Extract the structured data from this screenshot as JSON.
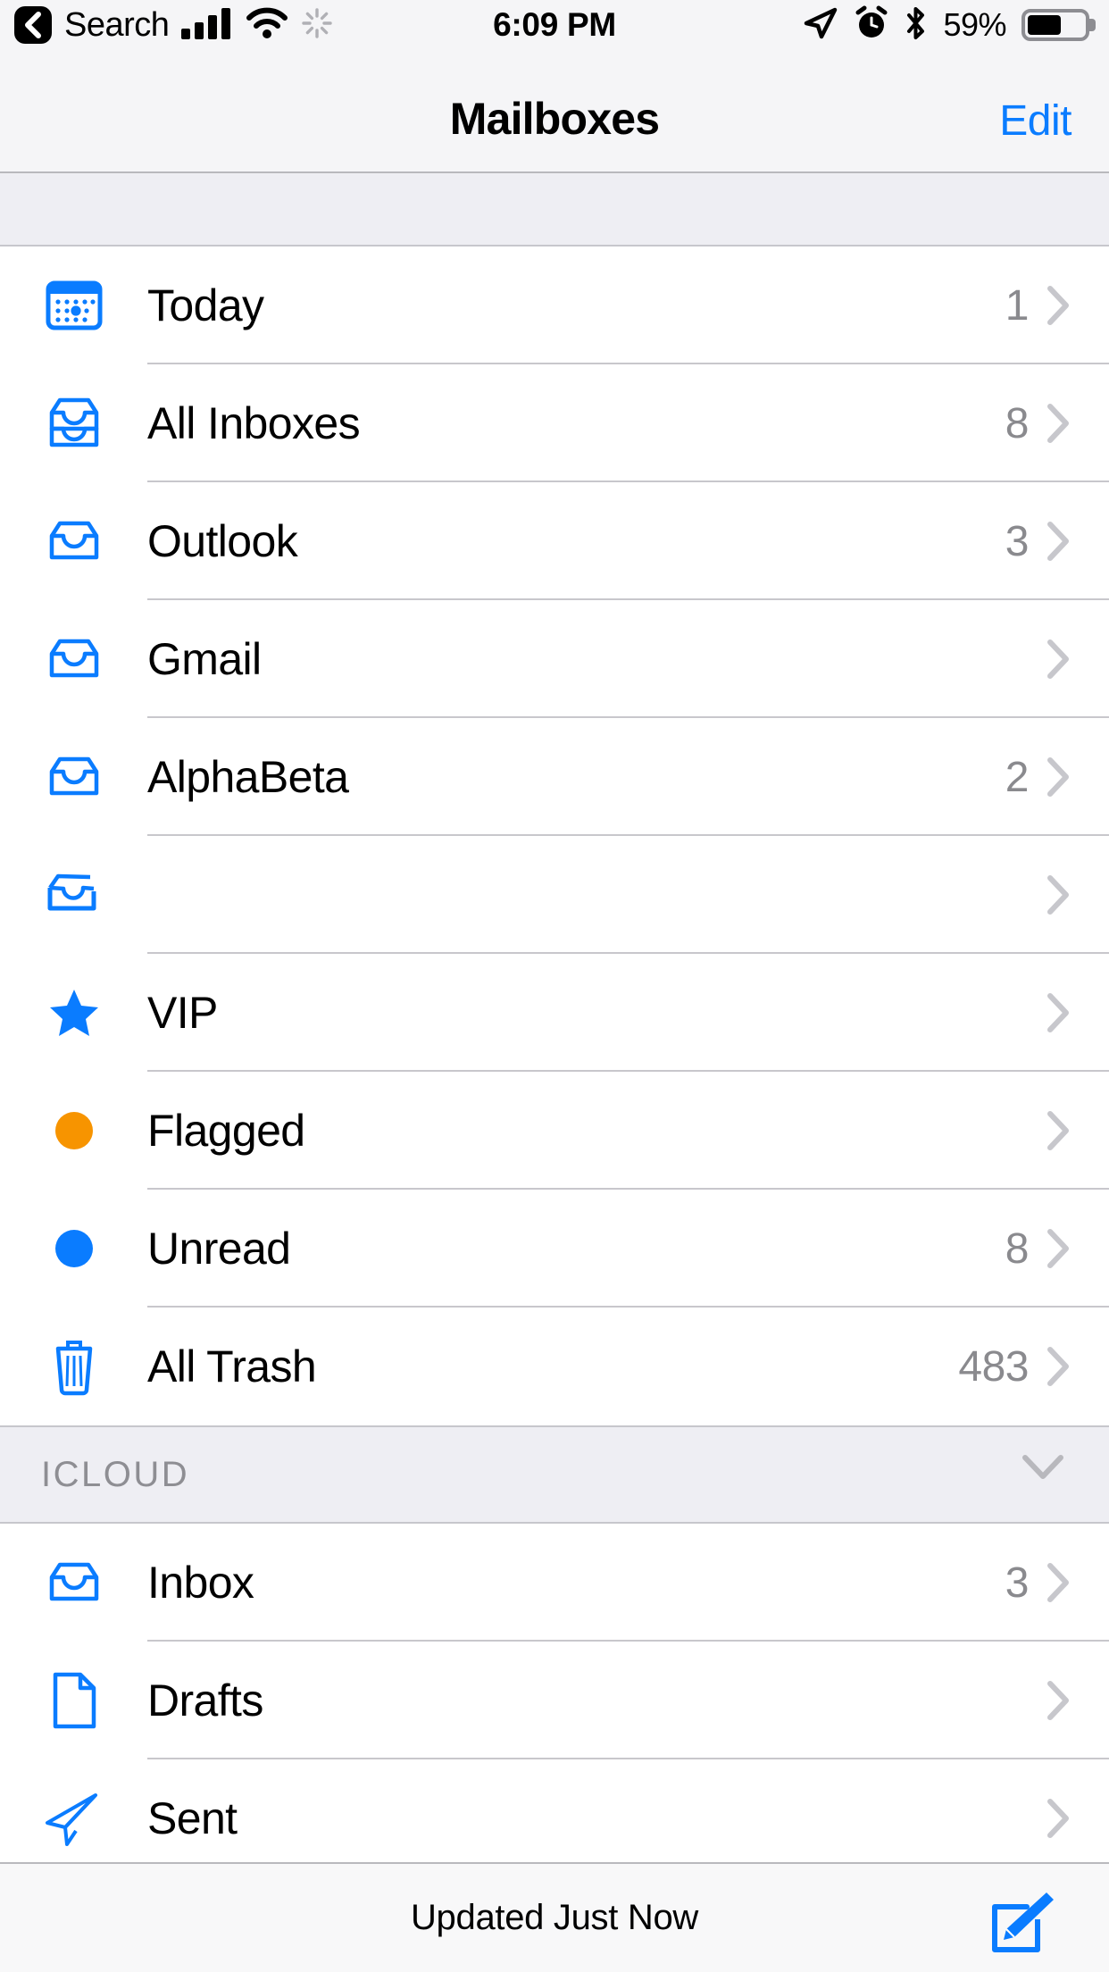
{
  "status_bar": {
    "back_label": "Search",
    "back_icon": "back-chevron-icon",
    "signal_icon": "cellular-signal-icon",
    "wifi_icon": "wifi-icon",
    "activity_icon": "activity-spinner-icon",
    "time": "6:09 PM",
    "location_icon": "location-arrow-icon",
    "alarm_icon": "alarm-clock-icon",
    "bluetooth_icon": "bluetooth-icon",
    "battery_percent": "59%",
    "battery_icon": "battery-icon",
    "battery_level": 59
  },
  "nav_bar": {
    "title": "Mailboxes",
    "edit_label": "Edit"
  },
  "colors": {
    "accent_blue": "#0a7cff",
    "flag_orange": "#f79400",
    "count_gray": "#8a8a8e",
    "section_bg": "#eeeef3",
    "separator": "#c8c7cc"
  },
  "sections": [
    {
      "id": "smart-mailboxes",
      "label": "",
      "collapsible": false,
      "rows": [
        {
          "label": "Today",
          "count": "1",
          "icon": "calendar-today-icon"
        },
        {
          "label": "All Inboxes",
          "count": "8",
          "icon": "stacked-inbox-tray-icon"
        },
        {
          "label": "Outlook",
          "count": "3",
          "icon": "inbox-tray-icon"
        },
        {
          "label": "Gmail",
          "count": "",
          "icon": "inbox-tray-icon"
        },
        {
          "label": "AlphaBeta",
          "count": "2",
          "icon": "inbox-tray-icon"
        },
        {
          "label": "",
          "count": "",
          "icon": "inbox-tray-partial-icon"
        },
        {
          "label": "VIP",
          "count": "",
          "icon": "star-icon"
        },
        {
          "label": "Flagged",
          "count": "",
          "icon": "orange-dot-icon"
        },
        {
          "label": "Unread",
          "count": "8",
          "icon": "blue-dot-icon"
        },
        {
          "label": "All Trash",
          "count": "483",
          "icon": "trash-icon"
        }
      ]
    },
    {
      "id": "icloud",
      "label": "ICLOUD",
      "collapsible": true,
      "collapse_icon": "chevron-down-icon",
      "rows": [
        {
          "label": "Inbox",
          "count": "3",
          "icon": "inbox-tray-icon"
        },
        {
          "label": "Drafts",
          "count": "",
          "icon": "draft-page-icon"
        },
        {
          "label": "Sent",
          "count": "",
          "icon": "paper-plane-icon"
        }
      ]
    }
  ],
  "toolbar": {
    "status_text": "Updated Just Now",
    "compose_icon": "compose-icon"
  }
}
